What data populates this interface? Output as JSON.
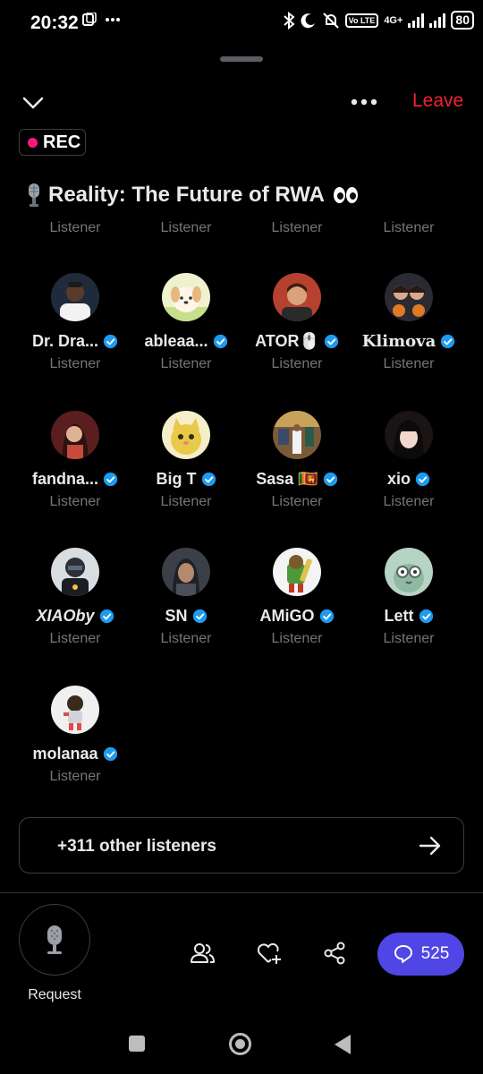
{
  "status_bar": {
    "time": "20:32",
    "signal_tag": "4G+",
    "volte_tag": "Vo LTE",
    "battery": "80"
  },
  "header": {
    "leave_label": "Leave",
    "rec_label": "REC"
  },
  "space": {
    "title": "Reality: The Future of RWA",
    "title_prefix_icon": "microphone-emoji",
    "title_suffix_icon": "eyes-emoji"
  },
  "cut_row_labels": [
    "Listener",
    "Listener",
    "Listener",
    "Listener"
  ],
  "listeners": [
    {
      "name": "Dr. Dra...",
      "role": "Listener",
      "verified": true,
      "avatar_bg": "#1f2a3a"
    },
    {
      "name": "ableaa...",
      "role": "Listener",
      "verified": true,
      "avatar_bg": "#eef2cf"
    },
    {
      "name": "ATOR🖱️",
      "role": "Listener",
      "verified": true,
      "avatar_bg": "#b5412e"
    },
    {
      "name": "Klimova",
      "role": "Listener",
      "verified": true,
      "avatar_bg": "#2b2a33"
    },
    {
      "name": "fandna...",
      "role": "Listener",
      "verified": true,
      "avatar_bg": "#5a1e1e"
    },
    {
      "name": "Big T",
      "role": "Listener",
      "verified": true,
      "avatar_bg": "#e8c94a"
    },
    {
      "name": "Sasa 🇱🇰",
      "role": "Listener",
      "verified": true,
      "avatar_bg": "#7b5a3a"
    },
    {
      "name": "xio",
      "role": "Listener",
      "verified": true,
      "avatar_bg": "#1a1414"
    },
    {
      "name": "XIAOby",
      "role": "Listener",
      "verified": true,
      "avatar_bg": "#2a2f38"
    },
    {
      "name": "SN",
      "role": "Listener",
      "verified": true,
      "avatar_bg": "#3b4048"
    },
    {
      "name": "AMiGO",
      "role": "Listener",
      "verified": true,
      "avatar_bg": "#f4f4f4"
    },
    {
      "name": "Lett",
      "role": "Listener",
      "verified": true,
      "avatar_bg": "#b6d4c4"
    },
    {
      "name": "molanaa",
      "role": "Listener",
      "verified": true,
      "avatar_bg": "#f0f0f0"
    }
  ],
  "other_listeners": {
    "label": "+311 other listeners"
  },
  "controls": {
    "request_label": "Request",
    "chat_count": "525"
  },
  "colors": {
    "accent_red": "#f4212e",
    "rec_dot": "#f91880",
    "verified_blue": "#1d9bf0",
    "chat_button": "#4f46e5",
    "muted_text": "#71767b"
  }
}
